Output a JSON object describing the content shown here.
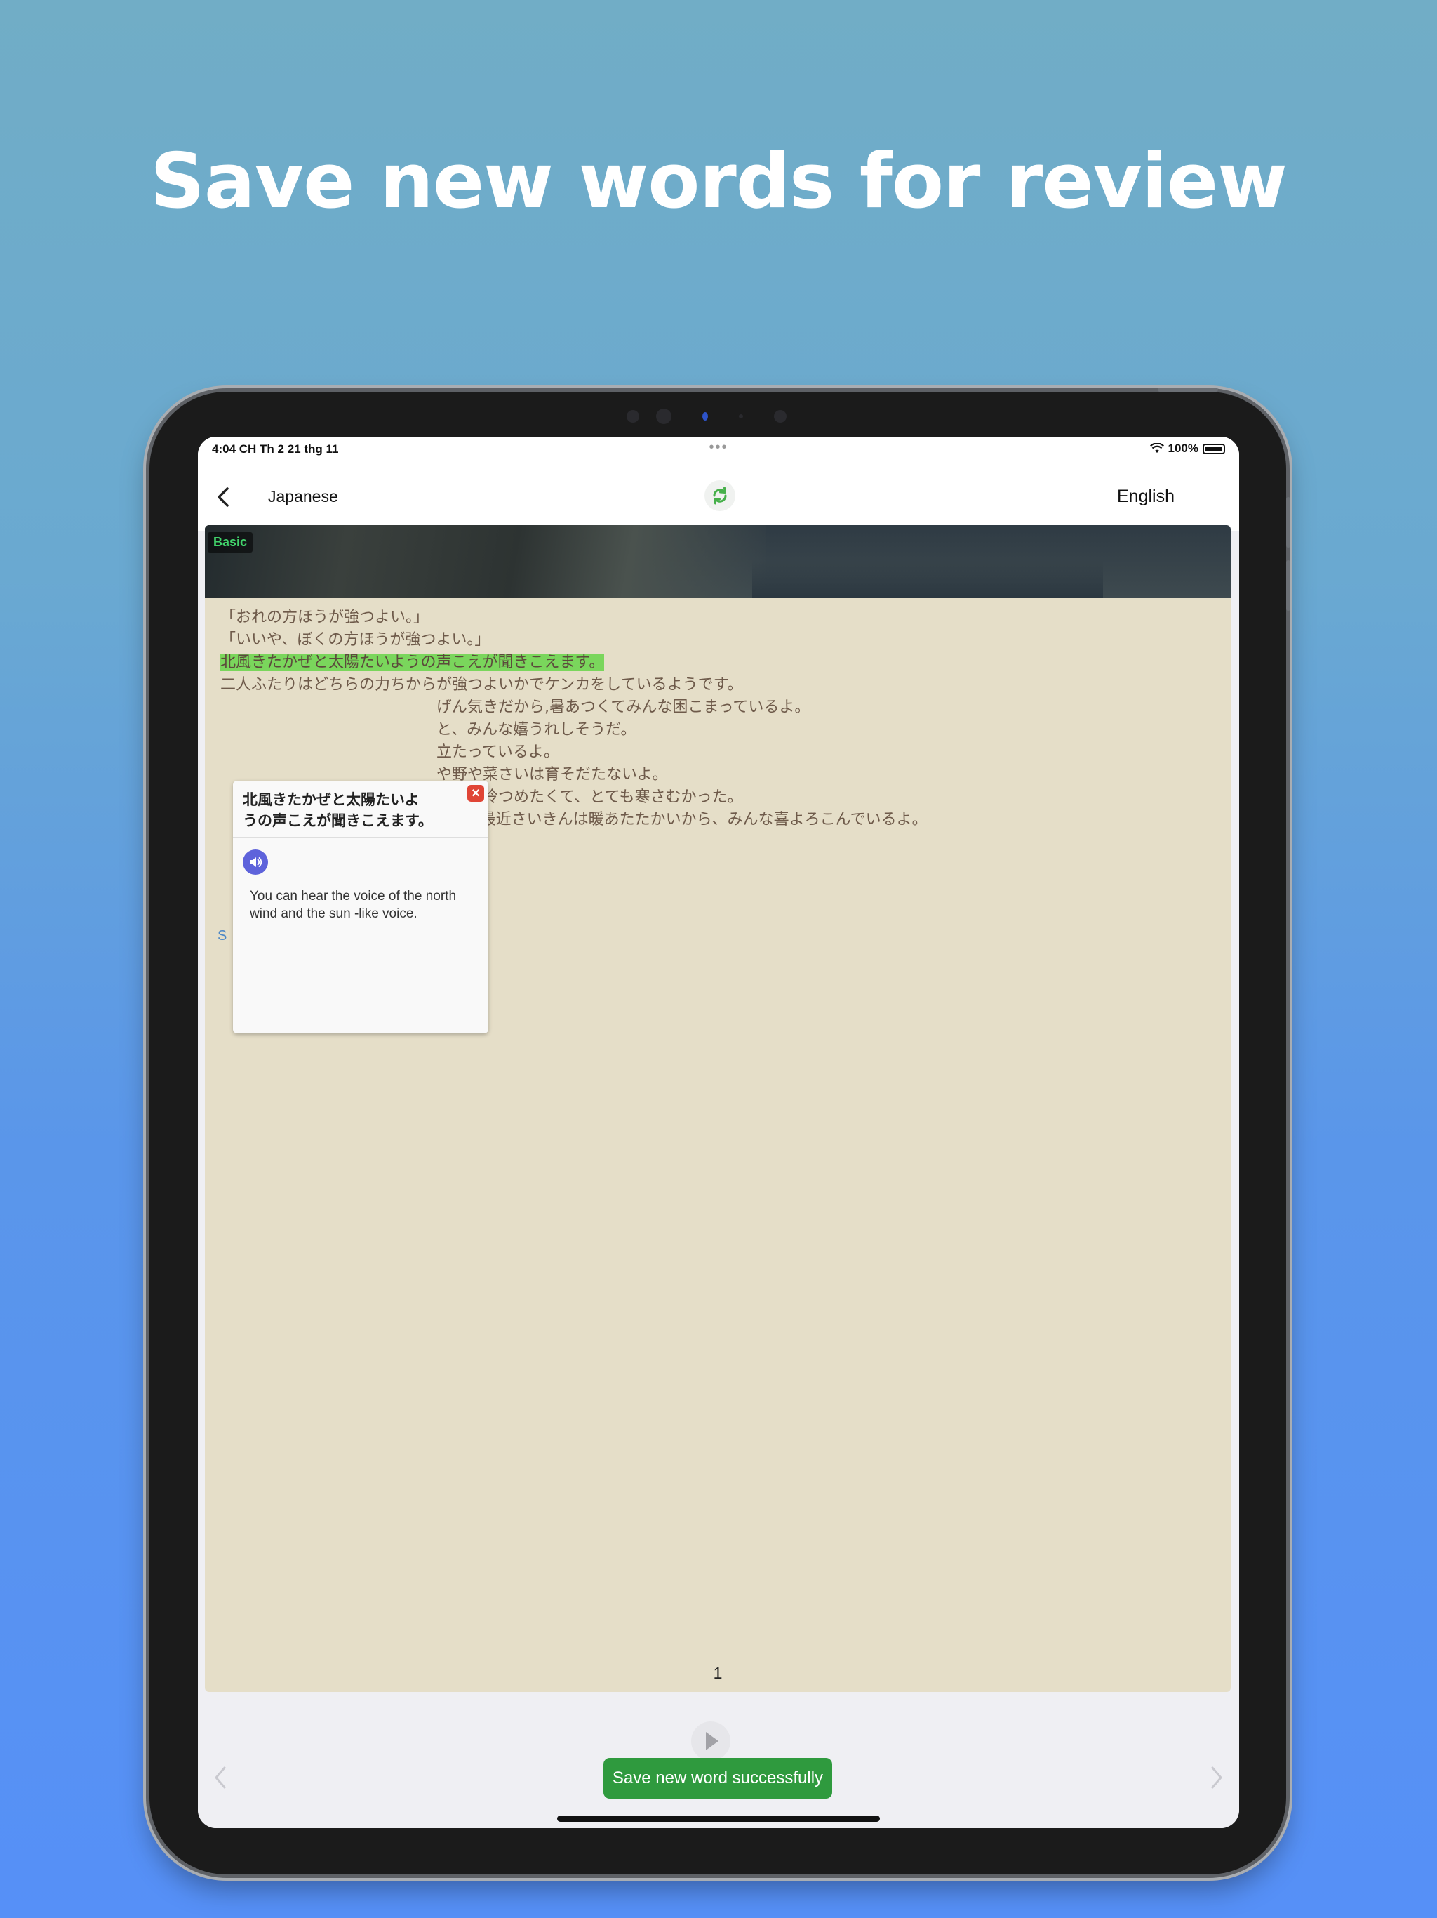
{
  "headline": "Save new words for review",
  "status_bar": {
    "time": "4:04 CH   Th 2 21 thg 11",
    "battery": "100%"
  },
  "nav": {
    "source_language": "Japanese",
    "target_language": "English"
  },
  "reader": {
    "level_badge": "Basic",
    "lines": [
      "「おれの方ほうが強つよい。」",
      "「いいや、ぼくの方ほうが強つよい。」",
      "北風きたかぜと太陽たいようの声こえが聞きこえます。",
      "二人ふたりはどちらの力ちからが強つよいかでケンカをしているようです。",
      "　　　　　　　　　　　　　　げん気きだから,暑あつくてみんな困こまっているよ。",
      "　　　　　　　　　　　　　　と、みんな嬉うれしそうだ。",
      "　　　　　　　　　　　　　　立たっているよ。",
      "　　　　　　　　　　　　　　や野や菜さいは育そだたないよ。",
      "　　　　　　　　　　　　　　かぜが冷つめたくて、とても寒さむかった。",
      "　　　　　　　　　　　　　　よね? 最近さいきんは暖あたたかいから、みんな喜よろこんでいるよ。"
    ],
    "stray_text": "S",
    "page_number": "1"
  },
  "popup": {
    "title": "北風きたかぜと太陽たいよ\nうの声こえが聞きこえます。",
    "translation": "You can hear the voice of the north wind and the sun -like voice."
  },
  "toast": "Save new word successfully",
  "colors": {
    "highlight": "#7ad65c",
    "toast_bg": "#2f9a3e",
    "sound_button": "#5e63db",
    "close_button": "#e04536",
    "badge_text": "#41d36b",
    "refresh_icon": "#46b04a"
  },
  "icons": {
    "back": "chevron-left-icon",
    "refresh": "refresh-icon",
    "close": "close-icon",
    "sound": "speaker-icon",
    "play": "play-icon",
    "prev": "chevron-left-icon",
    "next": "chevron-right-icon"
  }
}
